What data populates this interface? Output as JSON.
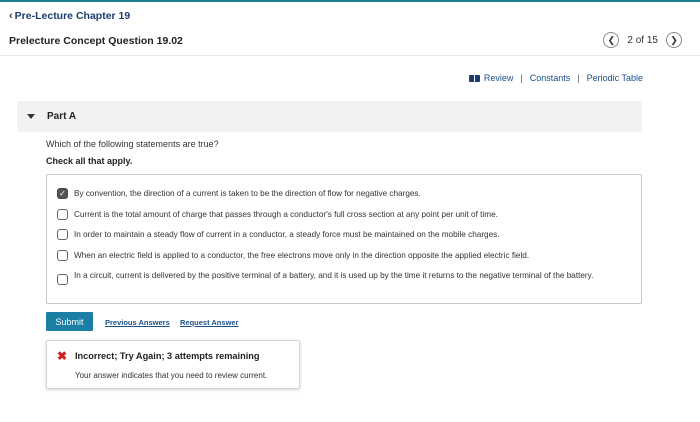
{
  "nav": {
    "back_label": "Pre-Lecture Chapter 19"
  },
  "header": {
    "title": "Prelecture Concept Question 19.02"
  },
  "pager": {
    "text": "2 of 15"
  },
  "resources": {
    "review": "Review",
    "constants": "Constants",
    "periodic_table": "Periodic Table"
  },
  "part": {
    "label": "Part A"
  },
  "question": {
    "prompt": "Which of the following statements are true?",
    "instruction": "Check all that apply."
  },
  "options": [
    {
      "text": "By convention, the direction of a current is taken to be the direction of flow for negative charges.",
      "checked": true
    },
    {
      "text": "Current is the total amount of charge that passes through a conductor's full cross section at any point per unit of time.",
      "checked": false
    },
    {
      "text": "In order to maintain a steady flow of current in a conductor, a steady force must be maintained on the mobile charges.",
      "checked": false
    },
    {
      "text": "When an electric field is applied to a conductor, the free electrons move only in the direction opposite the applied electric field.",
      "checked": false
    },
    {
      "text": "In a circuit, current is delivered by the positive terminal of a battery, and it is used up by the time it returns to the negative terminal of the battery.",
      "checked": false
    }
  ],
  "actions": {
    "submit": "Submit",
    "previous_answers": "Previous Answers",
    "request_answer": "Request Answer"
  },
  "feedback": {
    "title": "Incorrect; Try Again; 3 attempts remaining",
    "message": "Your answer indicates that you need to review current."
  },
  "colors": {
    "accent": "#1a7ea5",
    "link": "#1b4f8a",
    "error": "#cc2222"
  }
}
